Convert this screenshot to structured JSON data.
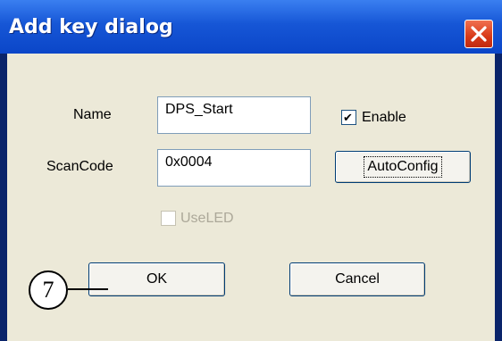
{
  "window": {
    "title": "Add key dialog",
    "close_icon": "close-icon"
  },
  "form": {
    "name_label": "Name",
    "name_value": "DPS_Start",
    "scancode_label": "ScanCode",
    "scancode_value": "0x0004",
    "enable_label": "Enable",
    "enable_checked": true,
    "useled_label": "UseLED",
    "useled_checked": false,
    "useled_enabled": false
  },
  "buttons": {
    "autoconfig_label": "AutoConfig",
    "ok_label": "OK",
    "cancel_label": "Cancel"
  },
  "annotation": {
    "callout_number": "7"
  },
  "colors": {
    "titlebar": "#0b46c8",
    "close_button": "#d83a18",
    "dialog_background": "#ece9d8"
  }
}
